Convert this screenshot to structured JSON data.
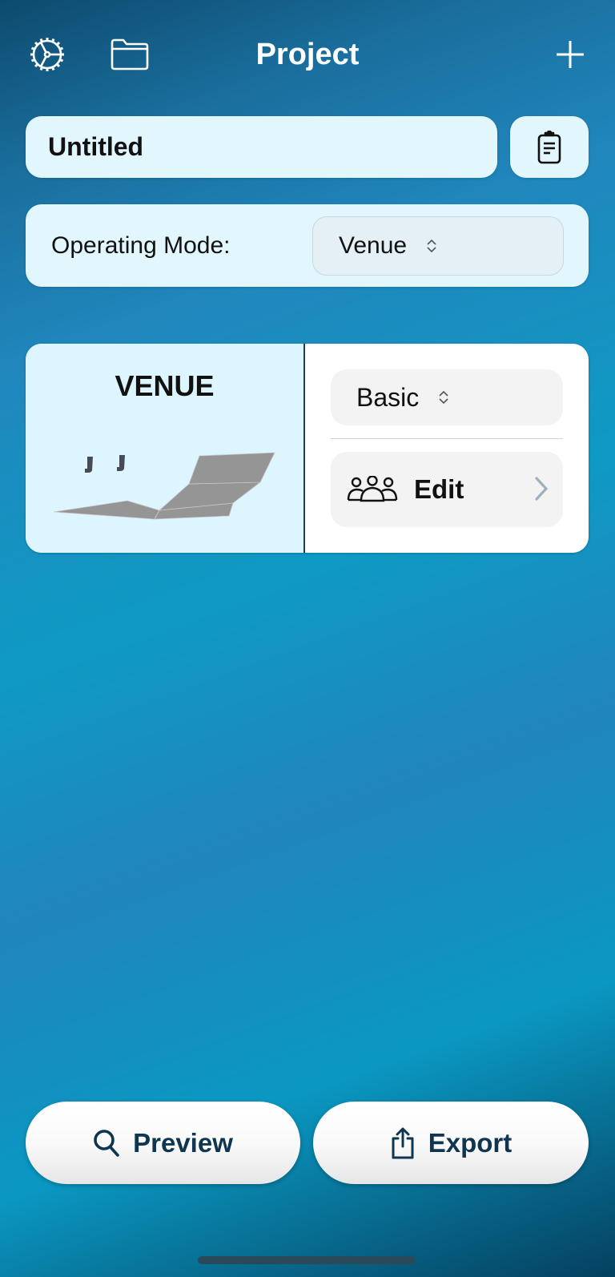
{
  "header": {
    "title": "Project",
    "icons": [
      "settings-gear-icon",
      "folder-icon",
      "plus-icon"
    ]
  },
  "project": {
    "name_value": "Untitled",
    "clipboard_icon": "clipboard-icon"
  },
  "operating_mode": {
    "label": "Operating Mode:",
    "selected": "Venue"
  },
  "venue_card": {
    "title": "VENUE",
    "preset_selected": "Basic",
    "edit_label": "Edit",
    "edit_icon": "people-group-icon"
  },
  "footer": {
    "preview_label": "Preview",
    "export_label": "Export"
  },
  "colors": {
    "accent_text": "#0f3650",
    "card_bg": "#e2f6fd",
    "chevron": "#9fb0bb"
  }
}
